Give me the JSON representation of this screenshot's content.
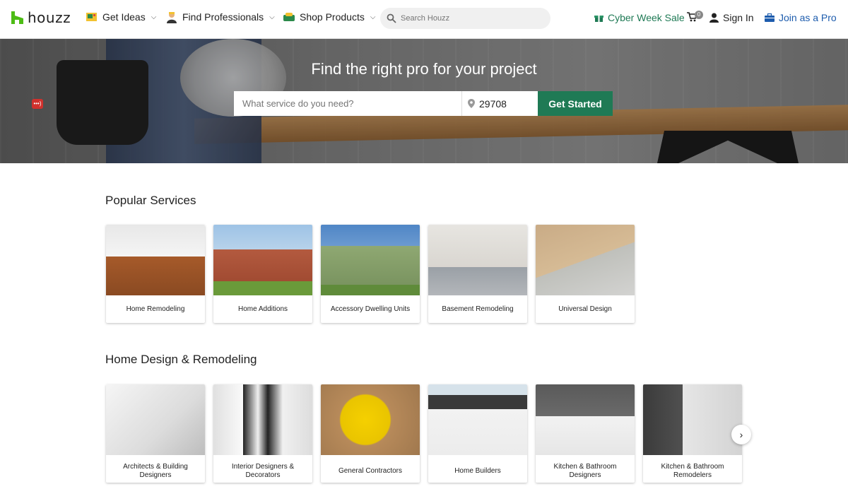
{
  "header": {
    "logo_text": "houzz",
    "nav": [
      {
        "label": "Get Ideas",
        "icon": "ideas-icon"
      },
      {
        "label": "Find Professionals",
        "icon": "professional-icon"
      },
      {
        "label": "Shop Products",
        "icon": "shop-icon"
      }
    ],
    "search_placeholder": "Search Houzz",
    "promo": "Cyber Week Sale",
    "cart_count": "0",
    "sign_in": "Sign In",
    "join_pro": "Join as a Pro"
  },
  "hero": {
    "title": "Find the right pro for your project",
    "service_placeholder": "What service do you need?",
    "zip_value": "29708",
    "cta": "Get Started",
    "side_badge": "•••)"
  },
  "popular": {
    "title": "Popular Services",
    "cards": [
      {
        "label": "Home Remodeling"
      },
      {
        "label": "Home Additions"
      },
      {
        "label": "Accessory Dwelling Units"
      },
      {
        "label": "Basement Remodeling"
      },
      {
        "label": "Universal Design"
      }
    ]
  },
  "design": {
    "title": "Home Design & Remodeling",
    "cards": [
      {
        "label": "Architects & Building Designers"
      },
      {
        "label": "Interior Designers & Decorators"
      },
      {
        "label": "General Contractors"
      },
      {
        "label": "Home Builders"
      },
      {
        "label": "Kitchen & Bathroom Designers"
      },
      {
        "label": "Kitchen & Bathroom Remodelers"
      }
    ],
    "next": "›"
  },
  "colors": {
    "brand_green": "#1f7a55",
    "link_blue": "#1d5cad",
    "logo_green": "#4dbc15"
  }
}
